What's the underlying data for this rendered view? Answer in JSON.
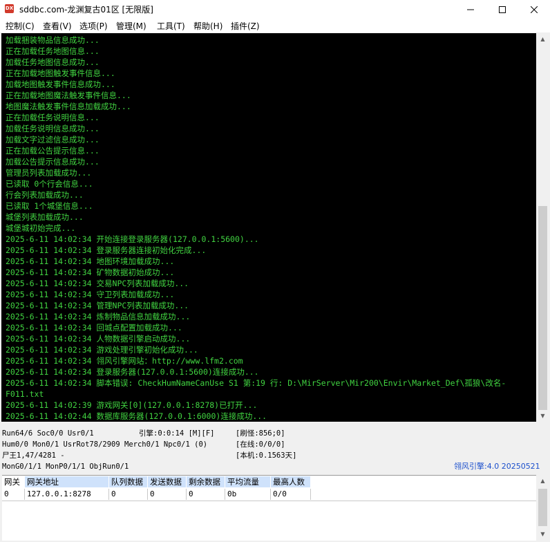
{
  "window": {
    "title": "sddbc.com-龙渊复古01区 [无限版]",
    "icon_text": "DX"
  },
  "menu": [
    "控制(C)",
    "查看(V)",
    "选项(P)",
    "管理(M)",
    "工具(T)",
    "帮助(H)",
    "插件(Z)"
  ],
  "log_lines": [
    "加载捆装物品信息成功...",
    "正在加载任务地图信息...",
    "加载任务地图信息成功...",
    "正在加载地图触发事件信息...",
    "加载地图触发事件信息成功...",
    "正在加载地图魔法触发事件信息...",
    "地图魔法触发事件信息加载成功...",
    "正在加载任务说明信息...",
    "加载任务说明信息成功...",
    "加载文字过滤信息成功...",
    "正在加载公告提示信息...",
    "加载公告提示信息成功...",
    "管理员列表加载成功...",
    "已读取 0个行会信息...",
    "行会列表加载成功...",
    "已读取 1个城堡信息...",
    "城堡列表加载成功...",
    "城堡城初始完成...",
    "2025-6-11 14:02:34 开始连接登录服务器(127.0.0.1:5600)...",
    "2025-6-11 14:02:34 登录服务器连接初始化完成...",
    "2025-6-11 14:02:34 地图环境加载成功...",
    "2025-6-11 14:02:34 矿物数据初始成功...",
    "2025-6-11 14:02:34 交易NPC列表加载成功...",
    "2025-6-11 14:02:34 守卫列表加载成功...",
    "2025-6-11 14:02:34 管理NPC列表加载成功...",
    "2025-6-11 14:02:34 炼制物品信息加载成功...",
    "2025-6-11 14:02:34 回城点配置加载成功...",
    "2025-6-11 14:02:34 人物数据引擎启动成功...",
    "2025-6-11 14:02:34 游戏处理引擎初始化成功...",
    "2025-6-11 14:02:34 翎风引擎网站：http://www.lfm2.com",
    "2025-6-11 14:02:34 登录服务器(127.0.0.1:5600)连接成功...",
    "2025-6-11 14:02:34 脚本错误: CheckHumNameCanUse S1 第:19 行: D:\\MirServer\\Mir200\\Envir\\Market_Def\\孤狼\\改名-",
    "F011.txt",
    "2025-6-11 14:02:39 游戏网关[0](127.0.0.1:8278)已打开...",
    "2025-6-11 14:02:44 数据库服务器(127.0.0.1:6000)连接成功..."
  ],
  "status": {
    "line1_left": "Run64/6 Soc0/0 Usr0/1",
    "line1_mid": "引擎:0:0:14 [M][F]",
    "line1_right": "[刷怪:856;0]",
    "line2_left": "Hum0/0 Mon0/1 UsrRot78/2909 Merch0/1 Npc0/1 (0)",
    "line2_right": "[在线:0/0/0]",
    "line3_left": "尸王1,47/4281 -",
    "line3_right": "[本机:0.1563天]",
    "line4_left": "MonG0/1/1 MonP0/1/1 ObjRun0/1",
    "engine_version": "翎风引擎:4.0 20250521"
  },
  "gate_table": {
    "headers": [
      "网关",
      "网关地址",
      "队列数据",
      "发送数据",
      "剩余数据",
      "平均流量",
      "最高人数"
    ],
    "rows": [
      [
        "0",
        "127.0.0.1:8278",
        "0",
        "0",
        "0",
        "0b",
        "0/0"
      ]
    ]
  }
}
